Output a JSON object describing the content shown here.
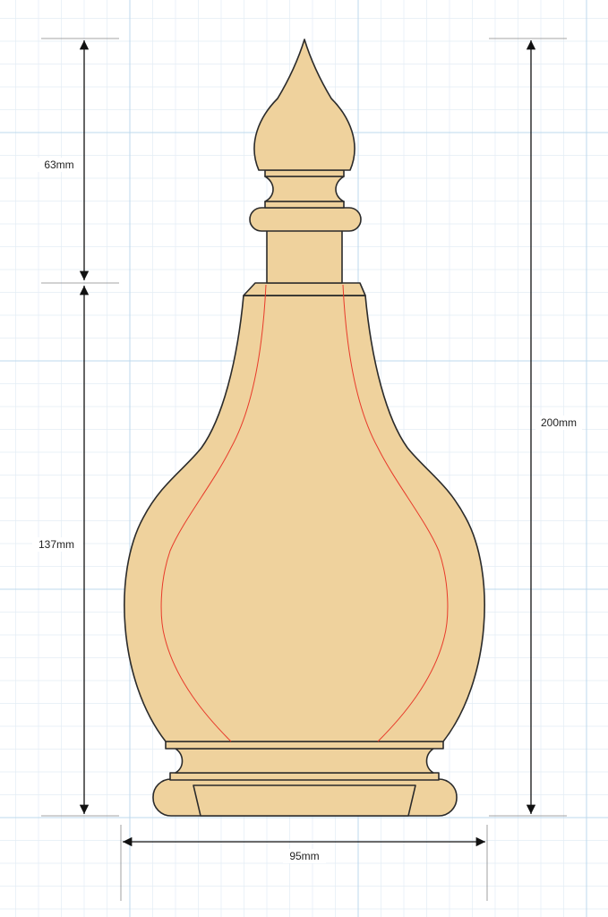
{
  "diagram": {
    "dimensions": {
      "stopper_height": "63mm",
      "body_height": "137mm",
      "total_height": "200mm",
      "width": "95mm"
    },
    "colors": {
      "background": "#ffffff",
      "grid_minor": "#e3edf5",
      "grid_major": "#bcd9ee",
      "fill": "#efd29d",
      "outline": "#2b2b2b",
      "guide": "#e83a2a",
      "dimension": "#111111",
      "extension": "#888888"
    }
  }
}
